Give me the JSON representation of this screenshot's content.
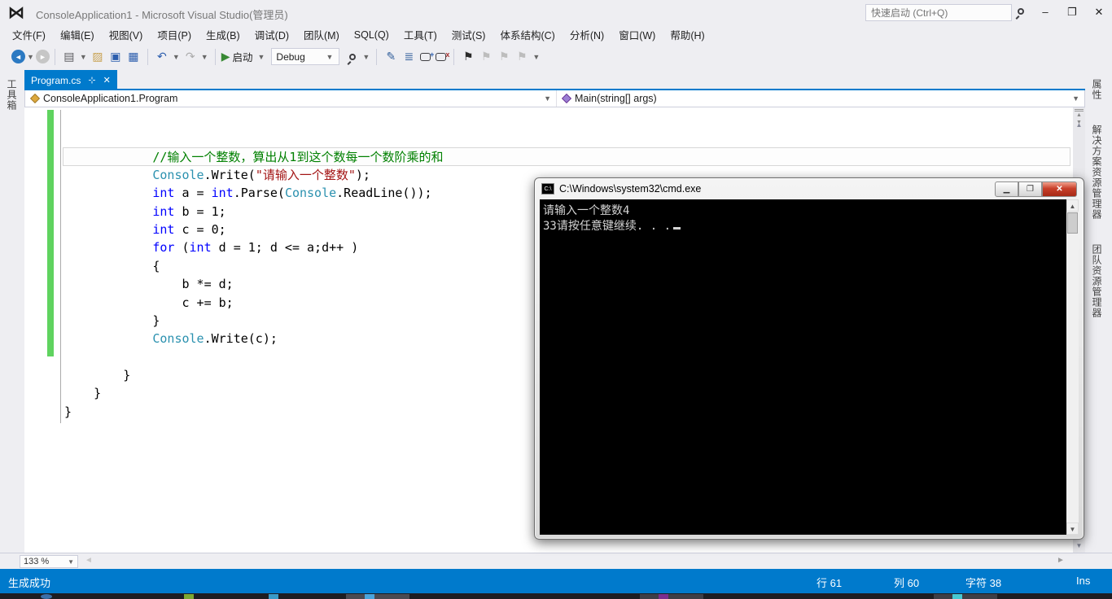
{
  "colors": {
    "accent": "#007ACC",
    "tab_active": "#007ACC",
    "status_bg": "#007ACC",
    "change_bar": "#5FD35F",
    "code_keyword": "#0000FF",
    "code_type": "#2B91AF",
    "code_string": "#A31515",
    "code_comment": "#008000"
  },
  "titlebar": {
    "title": "ConsoleApplication1 - Microsoft Visual Studio(管理员)",
    "quick_launch_placeholder": "快速启动 (Ctrl+Q)",
    "minimize": "–",
    "restore": "❐",
    "close": "✕"
  },
  "menus": [
    "文件(F)",
    "编辑(E)",
    "视图(V)",
    "项目(P)",
    "生成(B)",
    "调试(D)",
    "团队(M)",
    "SQL(Q)",
    "工具(T)",
    "测试(S)",
    "体系结构(C)",
    "分析(N)",
    "窗口(W)",
    "帮助(H)"
  ],
  "toolbar": {
    "start_label": "启动",
    "config_value": "Debug",
    "items": [
      {
        "type": "circle",
        "name": "nav-back-icon",
        "glyph": "◄"
      },
      {
        "type": "dd",
        "name": "nav-back-dropdown-icon"
      },
      {
        "type": "circle-gray",
        "name": "nav-forward-icon",
        "glyph": "►"
      },
      {
        "type": "sep"
      },
      {
        "type": "glyph",
        "name": "new-file-icon",
        "glyph": "▤",
        "color": "#5A5A5E"
      },
      {
        "type": "dd",
        "name": "new-file-dropdown-icon"
      },
      {
        "type": "glyph",
        "name": "open-file-icon",
        "glyph": "▨",
        "color": "#C8A252"
      },
      {
        "type": "glyph",
        "name": "save-icon",
        "glyph": "▣",
        "color": "#2B5DAD"
      },
      {
        "type": "glyph",
        "name": "save-all-icon",
        "glyph": "▦",
        "color": "#2B5DAD"
      },
      {
        "type": "sep"
      },
      {
        "type": "glyph",
        "name": "undo-icon",
        "glyph": "↶",
        "color": "#2B5DAD"
      },
      {
        "type": "dd",
        "name": "undo-dropdown-icon"
      },
      {
        "type": "glyph",
        "name": "redo-icon",
        "glyph": "↷",
        "color": "#ABABAB"
      },
      {
        "type": "dd",
        "name": "redo-dropdown-icon"
      },
      {
        "type": "sep"
      },
      {
        "type": "start",
        "name": "start-debugging-button"
      },
      {
        "type": "dd",
        "name": "start-dropdown-icon"
      },
      {
        "type": "combo",
        "name": "solution-configurations-combo"
      },
      {
        "type": "mag",
        "name": "find-in-files-icon"
      },
      {
        "type": "dd",
        "name": "toolbar-overflow-icon"
      },
      {
        "type": "sep"
      },
      {
        "type": "glyph",
        "name": "indent-icon",
        "glyph": "✎",
        "color": "#34609C"
      },
      {
        "type": "glyph",
        "name": "outdent-icon",
        "glyph": "≣",
        "color": "#34609C"
      },
      {
        "type": "bubble-add",
        "name": "comment-lines-icon"
      },
      {
        "type": "bubble-del",
        "name": "uncomment-lines-icon"
      },
      {
        "type": "sep"
      },
      {
        "type": "glyph",
        "name": "toggle-bookmark-icon",
        "glyph": "⚑",
        "color": "#2A2A2A"
      },
      {
        "type": "glyph",
        "name": "prev-bookmark-icon",
        "glyph": "⚑",
        "color": "#BDBDBD"
      },
      {
        "type": "glyph",
        "name": "next-bookmark-icon",
        "glyph": "⚑",
        "color": "#BDBDBD"
      },
      {
        "type": "glyph",
        "name": "clear-bookmarks-icon",
        "glyph": "⚑",
        "color": "#BDBDBD"
      },
      {
        "type": "dd",
        "name": "toolbar-options-icon"
      }
    ]
  },
  "document_tab": {
    "label": "Program.cs",
    "pin": "⊹",
    "close": "✕"
  },
  "navbar": {
    "left_value": "ConsoleApplication1.Program",
    "right_value": "Main(string[] args)"
  },
  "left_tabs": [
    "工具箱"
  ],
  "right_tabs": [
    "属性",
    "解决方案资源管理器",
    "团队资源管理器"
  ],
  "editor": {
    "caret_line_index": 2,
    "lines": [
      [],
      [],
      [
        [
          "com",
          "            //输入一个整数，算出从1到这个数每一个数阶乘的和"
        ]
      ],
      [
        [
          "plain",
          "            "
        ],
        [
          "type",
          "Console"
        ],
        [
          "plain",
          ".Write("
        ],
        [
          "str",
          "\"请输入一个整数\""
        ],
        [
          "plain",
          ");"
        ]
      ],
      [
        [
          "plain",
          "            "
        ],
        [
          "kw",
          "int"
        ],
        [
          "plain",
          " a = "
        ],
        [
          "kw",
          "int"
        ],
        [
          "plain",
          ".Parse("
        ],
        [
          "type",
          "Console"
        ],
        [
          "plain",
          ".ReadLine());"
        ]
      ],
      [
        [
          "plain",
          "            "
        ],
        [
          "kw",
          "int"
        ],
        [
          "plain",
          " b = 1;"
        ]
      ],
      [
        [
          "plain",
          "            "
        ],
        [
          "kw",
          "int"
        ],
        [
          "plain",
          " c = 0;"
        ]
      ],
      [
        [
          "plain",
          "            "
        ],
        [
          "kw",
          "for"
        ],
        [
          "plain",
          " ("
        ],
        [
          "kw",
          "int"
        ],
        [
          "plain",
          " d = 1; d <= a;d++ )"
        ]
      ],
      [
        [
          "plain",
          "            {"
        ]
      ],
      [
        [
          "plain",
          "                b *= d;"
        ]
      ],
      [
        [
          "plain",
          "                c += b;"
        ]
      ],
      [
        [
          "plain",
          "            }"
        ]
      ],
      [
        [
          "plain",
          "            "
        ],
        [
          "type",
          "Console"
        ],
        [
          "plain",
          ".Write(c);"
        ]
      ],
      [],
      [
        [
          "plain",
          "        }"
        ]
      ],
      [
        [
          "plain",
          "    }"
        ]
      ],
      [
        [
          "plain",
          "}"
        ]
      ]
    ]
  },
  "cmd": {
    "title": "C:\\Windows\\system32\\cmd.exe",
    "icon_label": "C:\\",
    "minimize": "▁",
    "maximize": "❐",
    "close": "✕",
    "lines": [
      {
        "text": "请输入一个整数4",
        "cursor": false
      },
      {
        "text": "33请按任意键继续. . .",
        "cursor": true
      }
    ]
  },
  "bottom": {
    "zoom_value": "133 %"
  },
  "statusbar": {
    "message": "生成成功",
    "fields": [
      "行 61",
      "列 60",
      "字符 38",
      "Ins"
    ]
  }
}
